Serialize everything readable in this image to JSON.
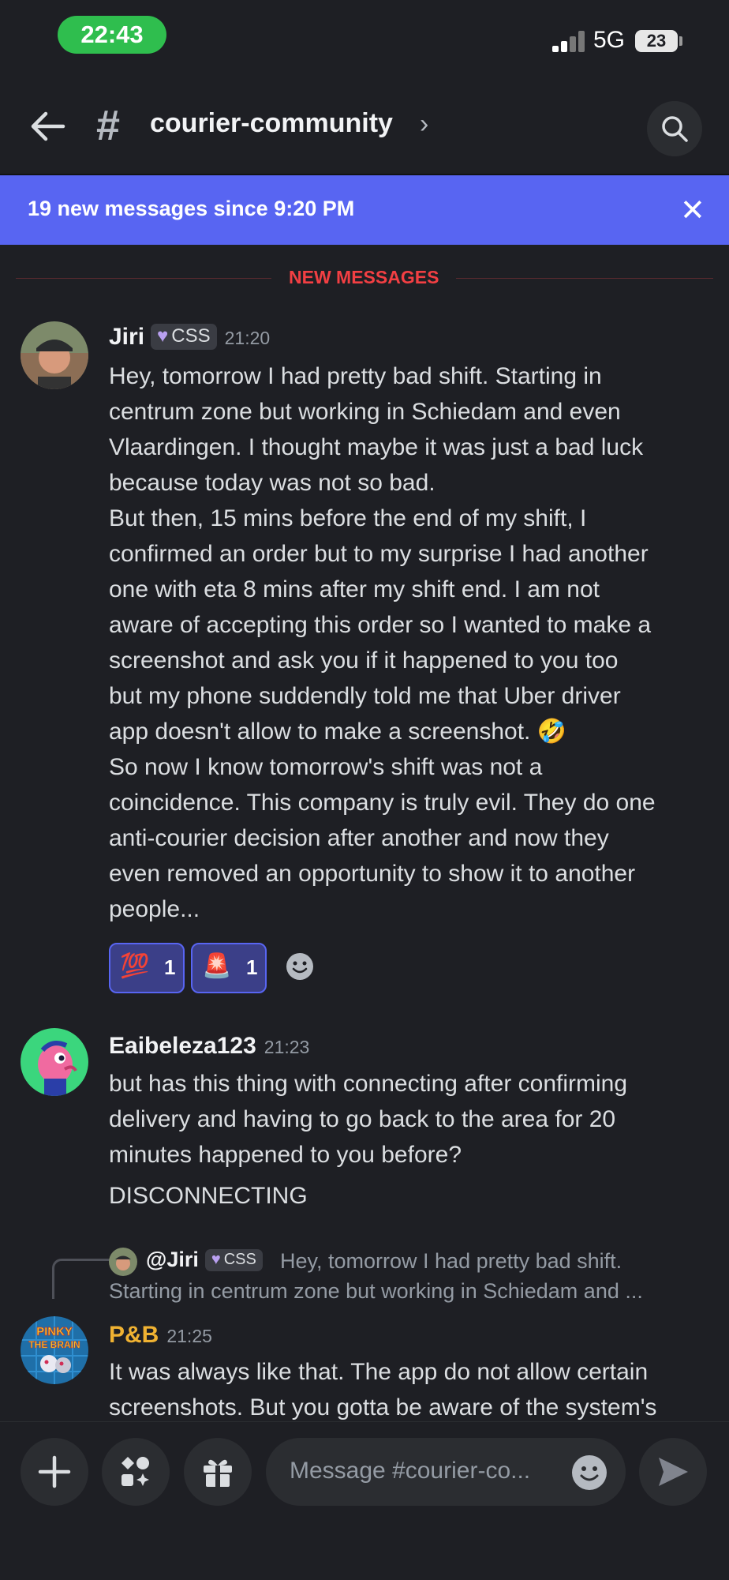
{
  "status_bar": {
    "time": "22:43",
    "network": "5G",
    "battery": "23"
  },
  "header": {
    "channel_name": "courier-community"
  },
  "banner": {
    "text": "19 new messages since 9:20 PM"
  },
  "divider": {
    "label": "NEW MESSAGES"
  },
  "messages": [
    {
      "author": "Jiri",
      "tag": "CSS",
      "time": "21:20",
      "lines": [
        "Hey, tomorrow I had pretty bad shift. Starting in",
        "centrum zone but working in Schiedam and even",
        "Vlaardingen. I thought maybe it was just a bad luck",
        "because today was not so bad.",
        "But then, 15 mins before the end of my shift, I",
        "confirmed an order but to my surprise I had another",
        "one with eta 8 mins after my shift end. I am not",
        "aware of accepting this order so I wanted to make a",
        "screenshot and ask you if it happened to you too",
        "but my phone suddendly told me that Uber driver",
        "app doesn't allow to make a screenshot. 🤣",
        "So now I know tomorrow's shift was not a",
        "coincidence. This company is truly evil. They do one",
        "anti-courier decision after another and now they",
        "even removed an opportunity to show it to another",
        "people..."
      ],
      "reactions": [
        {
          "emoji": "💯",
          "count": "1"
        },
        {
          "emoji": "🚨",
          "count": "1"
        }
      ]
    },
    {
      "author": "Eaibeleza123",
      "time": "21:23",
      "lines": [
        "but has this thing with connecting after confirming",
        "delivery and having to go back to the area for 20",
        "minutes happened to you before?"
      ],
      "extra": "DISCONNECTING"
    },
    {
      "reply": {
        "mention": "@Jiri",
        "tag": "CSS",
        "preview_1": "Hey, tomorrow I had pretty bad shift.",
        "preview_2": "Starting in centrum zone but working in Schiedam and ..."
      },
      "author": "P&B",
      "author_color": "#f0b232",
      "time": "21:25",
      "lines": [
        "It was always like that. The app do not allow certain",
        "screenshots. But you gotta be aware of the system's"
      ]
    }
  ],
  "composer": {
    "placeholder": "Message #courier-co..."
  }
}
